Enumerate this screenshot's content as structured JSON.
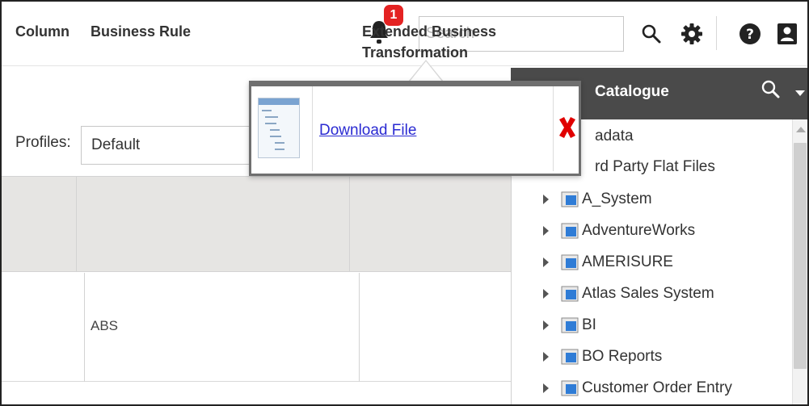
{
  "header": {
    "notification_count": "1",
    "search_placeholder": "Search"
  },
  "profiles": {
    "label": "Profiles:",
    "selected": "Default"
  },
  "grid": {
    "columns": [
      "Column",
      "Business Rule",
      "Extended Business Transformation"
    ],
    "rows": [
      {
        "business_rule": "ABS"
      },
      {
        "business_rule": ""
      }
    ]
  },
  "catalogue": {
    "title": "Catalogue",
    "top_items": [
      "adata",
      "rd Party Flat Files"
    ],
    "systems": [
      "A_System",
      "AdventureWorks",
      "AMERISURE",
      "Atlas Sales System",
      "BI",
      "BO Reports",
      "Customer Order Entry"
    ]
  },
  "download_popup": {
    "link_text": "Download File"
  },
  "colors": {
    "badge": "#e42222",
    "catalogue_header": "#4a4a4a",
    "grid_header": "#e6e5e3",
    "link": "#2a2ad2",
    "close": "#e00000"
  }
}
